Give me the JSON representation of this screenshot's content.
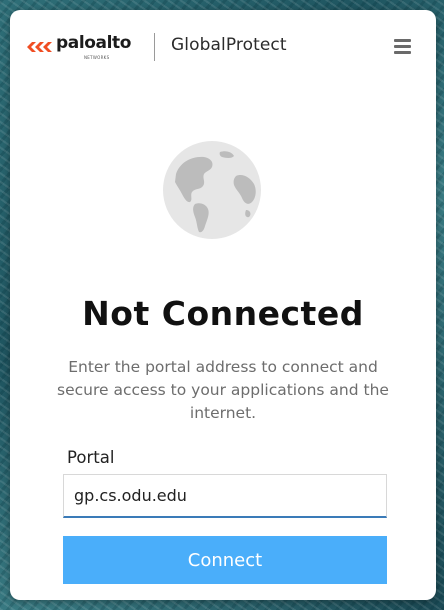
{
  "header": {
    "brand_name": "paloalto",
    "brand_sub": "NETWORKS",
    "app_title": "GlobalProtect",
    "menu_icon": "hamburger-menu-icon"
  },
  "status": {
    "icon": "globe-icon",
    "title": "Not Connected",
    "description": "Enter the portal address to connect and secure access to your applications and the internet."
  },
  "portal": {
    "label": "Portal",
    "value": "gp.cs.odu.edu"
  },
  "actions": {
    "connect_label": "Connect"
  },
  "colors": {
    "brand_orange": "#f04e23",
    "button_blue": "#4aaefa",
    "input_underline": "#3a7bb8",
    "globe_gray": "#e6e6e6"
  }
}
